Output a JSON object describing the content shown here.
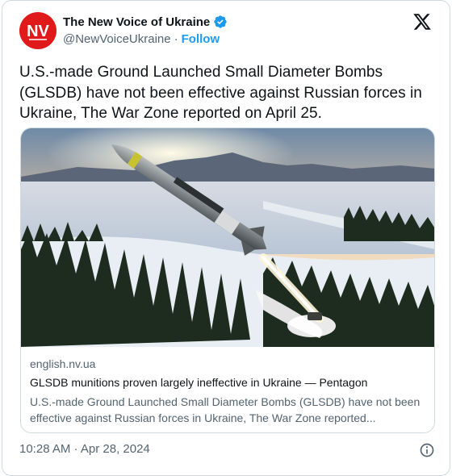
{
  "author": {
    "avatar_text": "NV",
    "display_name": "The New Voice of Ukraine",
    "handle": "@NewVoiceUkraine",
    "separator": "·",
    "follow_label": "Follow",
    "brand_color": "#e0191b"
  },
  "icons": {
    "verified": "verified-badge-icon",
    "x_logo": "x-logo-icon",
    "info": "info-icon"
  },
  "tweet": {
    "text": "U.S.-made Ground Launched Small Diameter Bombs (GLSDB) have not been effective against Russian forces in Ukraine, The War Zone reported on April 25."
  },
  "link_card": {
    "image_alt": "GLSDB bomb launched over snowy forest and lake",
    "domain": "english.nv.ua",
    "title": "GLSDB munitions proven largely ineffective in Ukraine — Pentagon",
    "description": "U.S.-made Ground Launched Small Diameter Bombs (GLSDB) have not been effective against Russian forces in Ukraine, The War Zone reported..."
  },
  "footer": {
    "timestamp": "10:28 AM · Apr 28, 2024"
  },
  "colors": {
    "link": "#1d9bf0",
    "secondary_text": "#536471",
    "border": "#cfd9de"
  }
}
